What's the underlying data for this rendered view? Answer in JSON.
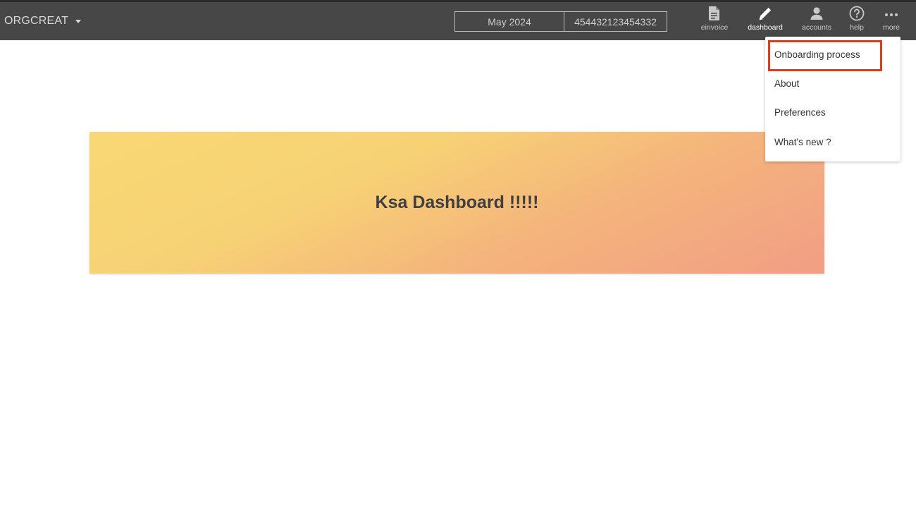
{
  "org": {
    "name": "ORGCREAT"
  },
  "period": {
    "month": "May 2024",
    "tin": "454432123454332"
  },
  "nav": {
    "einvoice": "einvoice",
    "dashboard": "dashboard",
    "accounts": "accounts",
    "help": "help",
    "more": "more"
  },
  "menu": {
    "items": [
      "Onboarding process",
      "About",
      "Preferences",
      "What's new ?"
    ],
    "highlight_color": "#e23a14"
  },
  "banner": {
    "title": "Ksa Dashboard !!!!!"
  },
  "colors": {
    "topbar": "#474747",
    "banner_start": "#f8d874",
    "banner_end": "#f29e85"
  }
}
